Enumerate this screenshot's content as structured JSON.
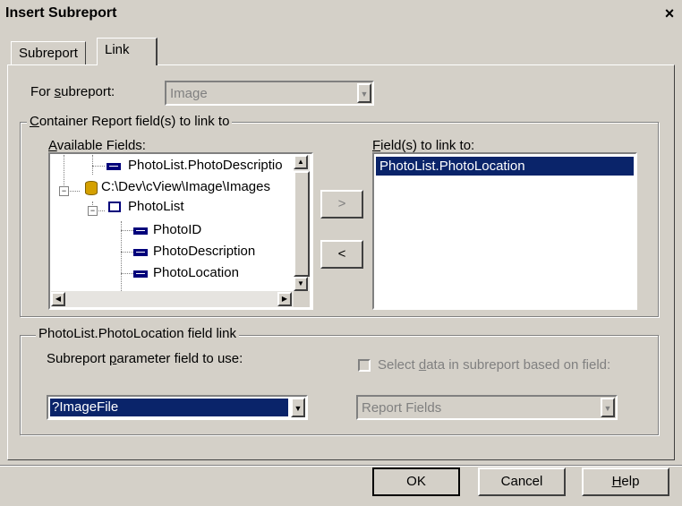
{
  "window": {
    "title": "Insert Subreport",
    "close_glyph": "×"
  },
  "tabs": [
    {
      "label": "Subreport",
      "active": false
    },
    {
      "label": "Link",
      "active": true
    }
  ],
  "for_subreport": {
    "label_pre": "For ",
    "label_key": "s",
    "label_post": "ubreport:",
    "value": "Image"
  },
  "container_group": {
    "legend_key": "C",
    "legend_rest": "ontainer Report field(s) to link to",
    "available_label_key": "A",
    "available_label_rest": "vailable Fields:",
    "tree_items": [
      "PhotoList.PhotoDescriptio",
      "C:\\Dev\\cView\\Image\\Images",
      "PhotoList",
      "PhotoID",
      "PhotoDescription",
      "PhotoLocation"
    ],
    "add_button": ">",
    "remove_button": "<",
    "linked_label_key": "F",
    "linked_label_rest": "ield(s) to link to:",
    "linked_items": [
      "PhotoList.PhotoLocation"
    ]
  },
  "field_link_group": {
    "legend": "PhotoList.PhotoLocation field link",
    "param_label_pre": "Subreport ",
    "param_label_key": "p",
    "param_label_post": "arameter field to use:",
    "param_value": "?ImageFile",
    "select_data_pre": "Select ",
    "select_data_key": "d",
    "select_data_post": "ata in subreport based on field:",
    "select_data_checked": false,
    "report_fields_value": "Report Fields"
  },
  "buttons": {
    "ok": "OK",
    "cancel": "Cancel",
    "help_key": "H",
    "help_rest": "elp"
  },
  "colors": {
    "face": "#d4d0c8",
    "selection": "#0a246a",
    "disabled_text": "#808080"
  }
}
